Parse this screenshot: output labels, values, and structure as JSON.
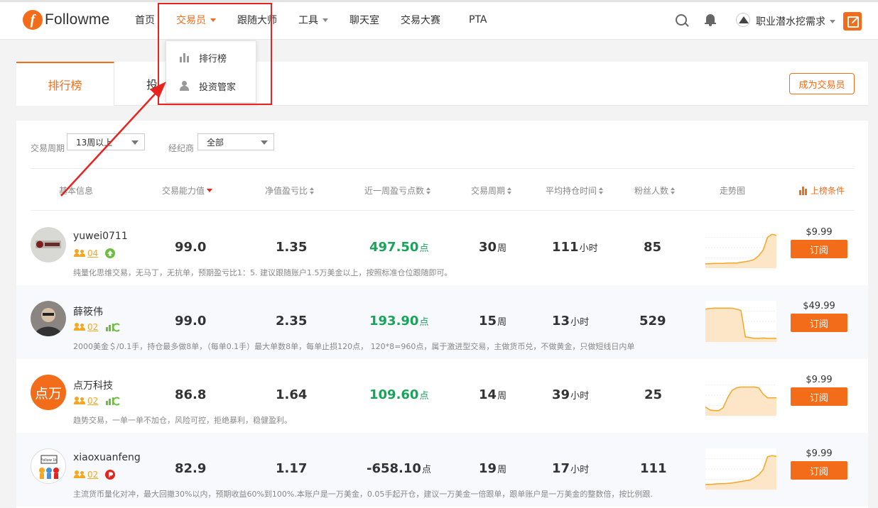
{
  "brand": {
    "name": "Followme",
    "mark": "f",
    "color": "#f26c1a"
  },
  "nav": [
    {
      "label": "首页",
      "active": false,
      "caret": false
    },
    {
      "label": "交易员",
      "active": true,
      "caret": true
    },
    {
      "label": "跟随大师",
      "active": false,
      "caret": false
    },
    {
      "label": "工具",
      "active": false,
      "caret": true
    },
    {
      "label": "聊天室",
      "active": false,
      "caret": false
    },
    {
      "label": "交易大赛",
      "active": false,
      "caret": false
    },
    {
      "label": "PTA",
      "active": false,
      "caret": false
    }
  ],
  "user": {
    "name": "职业潜水挖需求"
  },
  "dropdown": {
    "items": [
      {
        "label": "排行榜",
        "icon": "bar-chart-icon"
      },
      {
        "label": "投资管家",
        "icon": "person-icon"
      }
    ]
  },
  "tabs": {
    "active": "排行榜",
    "second": "投"
  },
  "become_trader": "成为交易员",
  "filters": {
    "period_label": "交易周期",
    "period_value": "13周以上",
    "broker_label": "经纪商",
    "broker_value": "全部"
  },
  "columns": {
    "info": "基本信息",
    "ability": "交易能力值",
    "profit_ratio": "净值盈亏比",
    "week_points": "近一周盈亏点数",
    "period": "交易周期",
    "hold_time": "平均持仓时间",
    "fans": "粉丝人数",
    "trend": "走势图",
    "condition": "上榜条件"
  },
  "rows": [
    {
      "name": "yuwei0711",
      "level": "04",
      "ability": "99.0",
      "ratio": "1.35",
      "points": "497.50",
      "points_unit": "点",
      "points_positive": true,
      "period": "30",
      "period_unit": "周",
      "hold": "111",
      "hold_unit": "小时",
      "fans": "85",
      "price": "$9.99",
      "subscribe": "订阅",
      "desc": "纯量化思维交易，无马丁，无抗单，预期盈亏比1：5. 建议跟随账户1.5万美金以上，按照标准仓位跟随即可。",
      "avatar_text": "",
      "trend": [
        0.08,
        0.08,
        0.09,
        0.09,
        0.09,
        0.1,
        0.1,
        0.1,
        0.12,
        0.14,
        0.16,
        0.2,
        0.3,
        0.45,
        0.8,
        0.88,
        0.85
      ]
    },
    {
      "name": "薛筱伟",
      "level": "02",
      "ability": "99.0",
      "ratio": "2.35",
      "points": "193.90",
      "points_unit": "点",
      "points_positive": true,
      "period": "15",
      "period_unit": "周",
      "hold": "13",
      "hold_unit": "小时",
      "fans": "529",
      "price": "$49.99",
      "subscribe": "订阅",
      "desc": "2000美金＄/0.1手，持仓最多做8单，（每单0.1手）最大单数8单，每单止损120点， 120*8=960点，属于激进型交易，主做货币兑，不做黄金，只做短线日内单",
      "avatar_text": "",
      "trend": [
        0.85,
        0.87,
        0.88,
        0.88,
        0.88,
        0.88,
        0.88,
        0.85,
        0.82,
        0.1,
        0.08,
        0.06,
        0.06,
        0.07,
        0.06,
        0.06,
        0.06
      ]
    },
    {
      "name": "点万科技",
      "level": "02",
      "ability": "86.8",
      "ratio": "1.64",
      "points": "109.60",
      "points_unit": "点",
      "points_positive": true,
      "period": "14",
      "period_unit": "周",
      "hold": "39",
      "hold_unit": "小时",
      "fans": "25",
      "price": "$9.99",
      "subscribe": "订阅",
      "desc": "趋势交易，一单一单不加仓，风险可控，拒绝暴利，稳健盈利。",
      "avatar_text": "点万",
      "trend": [
        0.2,
        0.12,
        0.1,
        0.1,
        0.18,
        0.45,
        0.65,
        0.72,
        0.74,
        0.74,
        0.74,
        0.74,
        0.72,
        0.55,
        0.45,
        0.45,
        0.45
      ]
    },
    {
      "name": "xiaoxuanfeng",
      "level": "02",
      "ability": "82.9",
      "ratio": "1.17",
      "points": "-658.10",
      "points_unit": "点",
      "points_positive": false,
      "period": "19",
      "period_unit": "周",
      "hold": "17",
      "hold_unit": "小时",
      "fans": "111",
      "price": "$9.99",
      "subscribe": "订阅",
      "desc": "主流货币量化对冲，最大回撤30%以内，预期收益60%到100%.本账户是一万美金，0.05手起开仓，建议一万美金一倍跟单，跟单账户是一万美金的整数倍，按比例跟.",
      "avatar_text": "Follow Us",
      "trend": [
        0.1,
        0.1,
        0.11,
        0.12,
        0.12,
        0.13,
        0.14,
        0.16,
        0.18,
        0.2,
        0.22,
        0.28,
        0.36,
        0.5,
        0.85,
        0.88,
        0.86
      ]
    }
  ]
}
